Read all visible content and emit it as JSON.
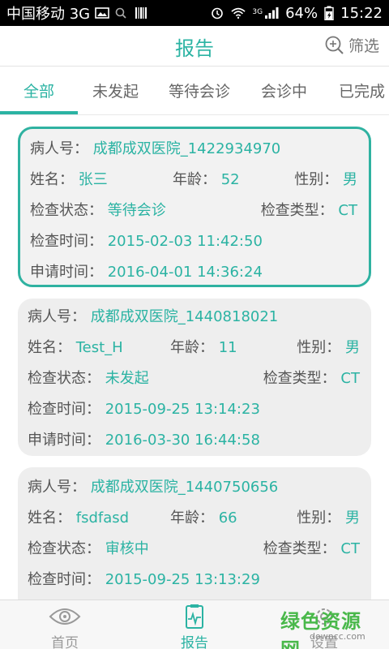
{
  "status_bar": {
    "carrier": "中国移动 3G",
    "network": "3G",
    "battery": "64%",
    "time": "15:22"
  },
  "app_bar": {
    "title": "报告",
    "filter_label": "筛选"
  },
  "tabs": [
    {
      "label": "全部",
      "active": true
    },
    {
      "label": "未发起",
      "active": false
    },
    {
      "label": "等待会诊",
      "active": false
    },
    {
      "label": "会诊中",
      "active": false
    },
    {
      "label": "已完成",
      "active": false
    }
  ],
  "labels": {
    "patient_id": "病人号：",
    "name": "姓名：",
    "age": "年龄：",
    "gender": "性别：",
    "check_status": "检查状态：",
    "check_type": "检查类型：",
    "check_time": "检查时间：",
    "apply_time": "申请时间："
  },
  "reports": [
    {
      "patient_id": "成都成双医院_1422934970",
      "name": "张三",
      "age": "52",
      "gender": "男",
      "check_status": "等待会诊",
      "check_type": "CT",
      "check_time": "2015-02-03 11:42:50",
      "apply_time": "2016-04-01 14:36:24"
    },
    {
      "patient_id": "成都成双医院_1440818021",
      "name": "Test_H",
      "age": "11",
      "gender": "男",
      "check_status": "未发起",
      "check_type": "CT",
      "check_time": "2015-09-25 13:14:23",
      "apply_time": "2016-03-30 16:44:58"
    },
    {
      "patient_id": "成都成双医院_1440750656",
      "name": "fsdfasd",
      "age": "66",
      "gender": "男",
      "check_status": "审核中",
      "check_type": "CT",
      "check_time": "2015-09-25 13:13:29",
      "apply_time": ""
    }
  ],
  "bottom_nav": [
    {
      "label": "首页",
      "icon": "eye-icon",
      "active": false
    },
    {
      "label": "报告",
      "icon": "report-icon",
      "active": true
    },
    {
      "label": "设置",
      "icon": "settings-icon",
      "active": false
    }
  ],
  "watermark": {
    "text": "绿色资源网",
    "url": "downcc.com"
  },
  "colors": {
    "accent": "#2bb3a3",
    "label": "#555555",
    "card_bg": "#eeeeee"
  }
}
